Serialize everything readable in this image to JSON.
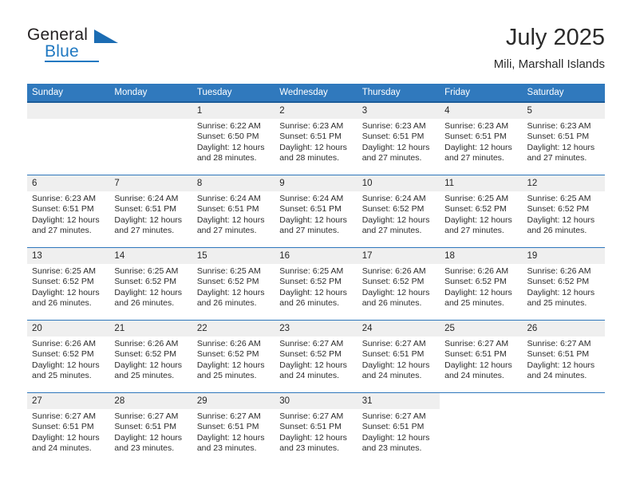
{
  "brand": {
    "word_general": "General",
    "word_blue": "Blue",
    "logo_icon": "triangle-logo-icon",
    "accent_color": "#1f78c1"
  },
  "header": {
    "title": "July 2025",
    "subtitle": "Mili, Marshall Islands"
  },
  "calendar": {
    "header_bg": "#3079bd",
    "header_border": "#1c5c99",
    "row_border": "#2e77bc",
    "daynum_bg": "#efefef",
    "weekdays": [
      "Sunday",
      "Monday",
      "Tuesday",
      "Wednesday",
      "Thursday",
      "Friday",
      "Saturday"
    ],
    "weeks": [
      [
        {
          "day": "",
          "sunrise": "",
          "sunset": "",
          "daylight": "",
          "empty": true
        },
        {
          "day": "",
          "sunrise": "",
          "sunset": "",
          "daylight": "",
          "empty": true
        },
        {
          "day": "1",
          "sunrise": "Sunrise: 6:22 AM",
          "sunset": "Sunset: 6:50 PM",
          "daylight": "Daylight: 12 hours and 28 minutes."
        },
        {
          "day": "2",
          "sunrise": "Sunrise: 6:23 AM",
          "sunset": "Sunset: 6:51 PM",
          "daylight": "Daylight: 12 hours and 28 minutes."
        },
        {
          "day": "3",
          "sunrise": "Sunrise: 6:23 AM",
          "sunset": "Sunset: 6:51 PM",
          "daylight": "Daylight: 12 hours and 27 minutes."
        },
        {
          "day": "4",
          "sunrise": "Sunrise: 6:23 AM",
          "sunset": "Sunset: 6:51 PM",
          "daylight": "Daylight: 12 hours and 27 minutes."
        },
        {
          "day": "5",
          "sunrise": "Sunrise: 6:23 AM",
          "sunset": "Sunset: 6:51 PM",
          "daylight": "Daylight: 12 hours and 27 minutes."
        }
      ],
      [
        {
          "day": "6",
          "sunrise": "Sunrise: 6:23 AM",
          "sunset": "Sunset: 6:51 PM",
          "daylight": "Daylight: 12 hours and 27 minutes."
        },
        {
          "day": "7",
          "sunrise": "Sunrise: 6:24 AM",
          "sunset": "Sunset: 6:51 PM",
          "daylight": "Daylight: 12 hours and 27 minutes."
        },
        {
          "day": "8",
          "sunrise": "Sunrise: 6:24 AM",
          "sunset": "Sunset: 6:51 PM",
          "daylight": "Daylight: 12 hours and 27 minutes."
        },
        {
          "day": "9",
          "sunrise": "Sunrise: 6:24 AM",
          "sunset": "Sunset: 6:51 PM",
          "daylight": "Daylight: 12 hours and 27 minutes."
        },
        {
          "day": "10",
          "sunrise": "Sunrise: 6:24 AM",
          "sunset": "Sunset: 6:52 PM",
          "daylight": "Daylight: 12 hours and 27 minutes."
        },
        {
          "day": "11",
          "sunrise": "Sunrise: 6:25 AM",
          "sunset": "Sunset: 6:52 PM",
          "daylight": "Daylight: 12 hours and 27 minutes."
        },
        {
          "day": "12",
          "sunrise": "Sunrise: 6:25 AM",
          "sunset": "Sunset: 6:52 PM",
          "daylight": "Daylight: 12 hours and 26 minutes."
        }
      ],
      [
        {
          "day": "13",
          "sunrise": "Sunrise: 6:25 AM",
          "sunset": "Sunset: 6:52 PM",
          "daylight": "Daylight: 12 hours and 26 minutes."
        },
        {
          "day": "14",
          "sunrise": "Sunrise: 6:25 AM",
          "sunset": "Sunset: 6:52 PM",
          "daylight": "Daylight: 12 hours and 26 minutes."
        },
        {
          "day": "15",
          "sunrise": "Sunrise: 6:25 AM",
          "sunset": "Sunset: 6:52 PM",
          "daylight": "Daylight: 12 hours and 26 minutes."
        },
        {
          "day": "16",
          "sunrise": "Sunrise: 6:25 AM",
          "sunset": "Sunset: 6:52 PM",
          "daylight": "Daylight: 12 hours and 26 minutes."
        },
        {
          "day": "17",
          "sunrise": "Sunrise: 6:26 AM",
          "sunset": "Sunset: 6:52 PM",
          "daylight": "Daylight: 12 hours and 26 minutes."
        },
        {
          "day": "18",
          "sunrise": "Sunrise: 6:26 AM",
          "sunset": "Sunset: 6:52 PM",
          "daylight": "Daylight: 12 hours and 25 minutes."
        },
        {
          "day": "19",
          "sunrise": "Sunrise: 6:26 AM",
          "sunset": "Sunset: 6:52 PM",
          "daylight": "Daylight: 12 hours and 25 minutes."
        }
      ],
      [
        {
          "day": "20",
          "sunrise": "Sunrise: 6:26 AM",
          "sunset": "Sunset: 6:52 PM",
          "daylight": "Daylight: 12 hours and 25 minutes."
        },
        {
          "day": "21",
          "sunrise": "Sunrise: 6:26 AM",
          "sunset": "Sunset: 6:52 PM",
          "daylight": "Daylight: 12 hours and 25 minutes."
        },
        {
          "day": "22",
          "sunrise": "Sunrise: 6:26 AM",
          "sunset": "Sunset: 6:52 PM",
          "daylight": "Daylight: 12 hours and 25 minutes."
        },
        {
          "day": "23",
          "sunrise": "Sunrise: 6:27 AM",
          "sunset": "Sunset: 6:52 PM",
          "daylight": "Daylight: 12 hours and 24 minutes."
        },
        {
          "day": "24",
          "sunrise": "Sunrise: 6:27 AM",
          "sunset": "Sunset: 6:51 PM",
          "daylight": "Daylight: 12 hours and 24 minutes."
        },
        {
          "day": "25",
          "sunrise": "Sunrise: 6:27 AM",
          "sunset": "Sunset: 6:51 PM",
          "daylight": "Daylight: 12 hours and 24 minutes."
        },
        {
          "day": "26",
          "sunrise": "Sunrise: 6:27 AM",
          "sunset": "Sunset: 6:51 PM",
          "daylight": "Daylight: 12 hours and 24 minutes."
        }
      ],
      [
        {
          "day": "27",
          "sunrise": "Sunrise: 6:27 AM",
          "sunset": "Sunset: 6:51 PM",
          "daylight": "Daylight: 12 hours and 24 minutes."
        },
        {
          "day": "28",
          "sunrise": "Sunrise: 6:27 AM",
          "sunset": "Sunset: 6:51 PM",
          "daylight": "Daylight: 12 hours and 23 minutes."
        },
        {
          "day": "29",
          "sunrise": "Sunrise: 6:27 AM",
          "sunset": "Sunset: 6:51 PM",
          "daylight": "Daylight: 12 hours and 23 minutes."
        },
        {
          "day": "30",
          "sunrise": "Sunrise: 6:27 AM",
          "sunset": "Sunset: 6:51 PM",
          "daylight": "Daylight: 12 hours and 23 minutes."
        },
        {
          "day": "31",
          "sunrise": "Sunrise: 6:27 AM",
          "sunset": "Sunset: 6:51 PM",
          "daylight": "Daylight: 12 hours and 23 minutes."
        },
        {
          "day": "",
          "sunrise": "",
          "sunset": "",
          "daylight": "",
          "blank": true
        },
        {
          "day": "",
          "sunrise": "",
          "sunset": "",
          "daylight": "",
          "blank": true
        }
      ]
    ]
  }
}
